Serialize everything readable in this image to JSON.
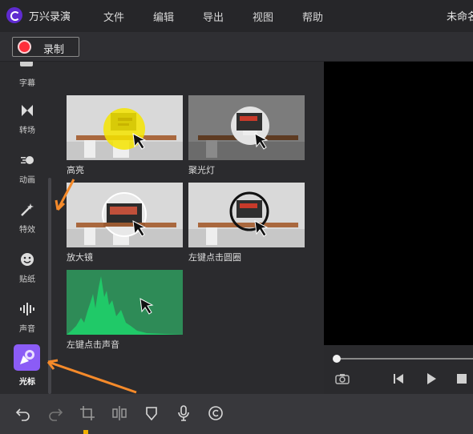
{
  "app": {
    "title": "万兴录演",
    "doc_title": "未命名"
  },
  "menu": [
    "文件",
    "编辑",
    "导出",
    "视图",
    "帮助"
  ],
  "toolbar": {
    "record_label": "录制"
  },
  "sidebar": {
    "items": [
      {
        "label": "字幕",
        "icon": "caption-icon"
      },
      {
        "label": "转场",
        "icon": "transition-icon"
      },
      {
        "label": "动画",
        "icon": "animation-icon"
      },
      {
        "label": "特效",
        "icon": "effects-wand-icon"
      },
      {
        "label": "贴纸",
        "icon": "sticker-icon"
      },
      {
        "label": "声音",
        "icon": "audio-wave-icon"
      },
      {
        "label": "光标",
        "icon": "cursor-icon",
        "active": true
      }
    ]
  },
  "effects": [
    {
      "label": "高亮",
      "kind": "highlight"
    },
    {
      "label": "聚光灯",
      "kind": "spotlight"
    },
    {
      "label": "放大镜",
      "kind": "magnifier"
    },
    {
      "label": "左键点击圆圈",
      "kind": "left-click-circle"
    },
    {
      "label": "左键点击声音",
      "kind": "left-click-sound"
    }
  ],
  "bottom_tools": [
    "undo-icon",
    "redo-icon",
    "crop-icon",
    "split-icon",
    "mask-icon",
    "microphone-icon",
    "copyright-icon"
  ],
  "colors": {
    "accent": "#8b5cf6",
    "record": "#ff2d3b",
    "annotation_arrow": "#f58a2a",
    "sound_card": "#2e8b57"
  },
  "playback": {
    "progress": 0
  }
}
